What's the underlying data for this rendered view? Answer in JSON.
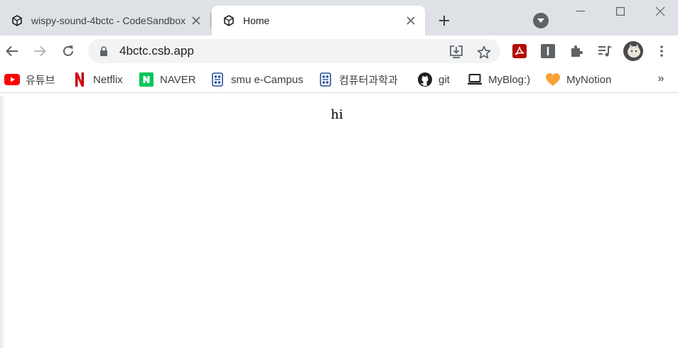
{
  "tabs": [
    {
      "title": "wispy-sound-4bctc - CodeSandbox",
      "active": false,
      "favicon": "codesandbox-icon"
    },
    {
      "title": "Home",
      "active": true,
      "favicon": "codesandbox-icon"
    }
  ],
  "toolbar": {
    "url": "4bctc.csb.app"
  },
  "bookmarks": [
    {
      "label": "유튜브",
      "icon": "youtube-icon"
    },
    {
      "label": "Netflix",
      "icon": "netflix-icon"
    },
    {
      "label": "NAVER",
      "icon": "naver-icon"
    },
    {
      "label": "smu e-Campus",
      "icon": "smu-icon"
    },
    {
      "label": "컴퓨터과학과",
      "icon": "smu-icon"
    },
    {
      "label": "git",
      "icon": "github-icon"
    },
    {
      "label": "MyBlog:)",
      "icon": "laptop-icon"
    },
    {
      "label": "MyNotion",
      "icon": "heart-icon"
    }
  ],
  "bookmarks_more": "»",
  "page": {
    "text": "hi"
  },
  "colors": {
    "tabstrip_bg": "#dee1e6",
    "omnibox_bg": "#f1f3f4",
    "youtube_red": "#ff0000",
    "netflix_red": "#e50914",
    "naver_green": "#03c75a",
    "heart_orange": "#f9a23a",
    "pdf_red": "#b30b00"
  }
}
